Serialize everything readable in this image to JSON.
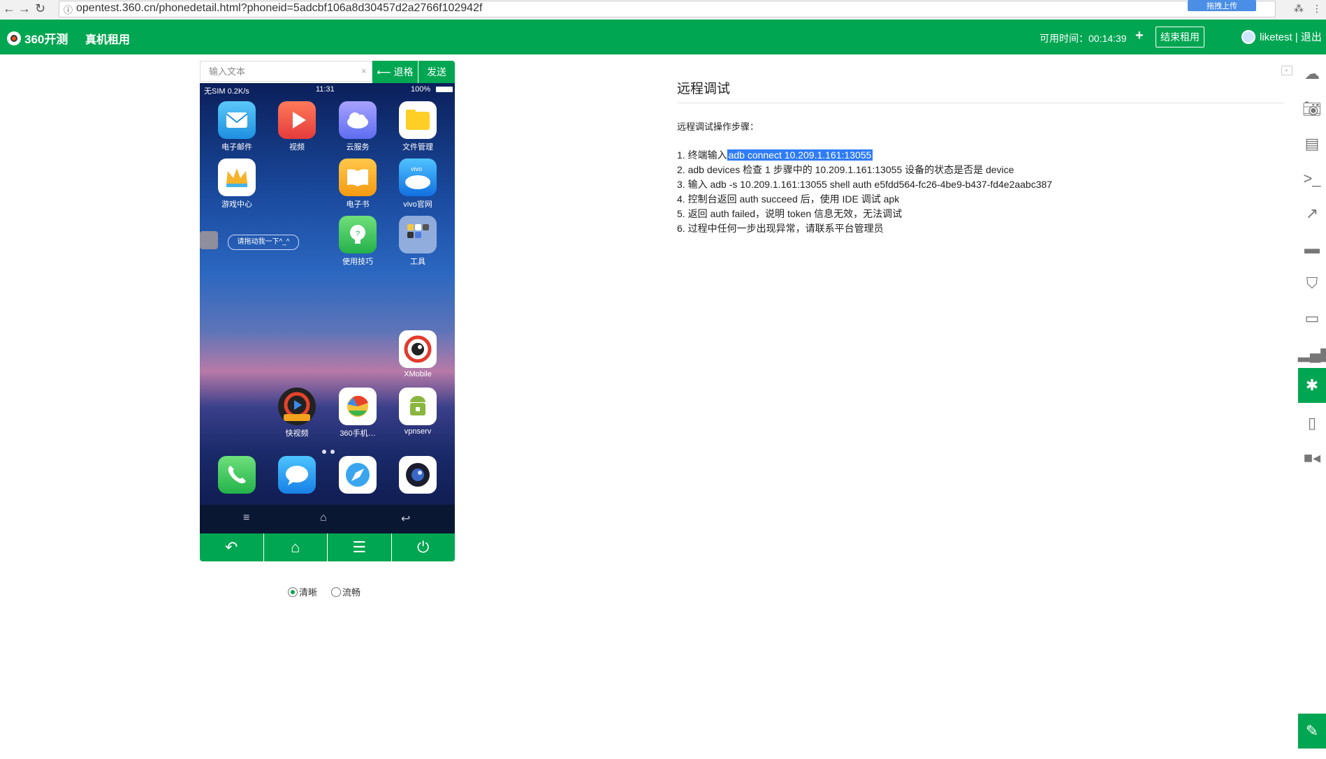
{
  "browser": {
    "url": "opentest.360.cn/phonedetail.html?phoneid=5adcbf106a8d30457d2a2766f102942f",
    "upload_label": "拖拽上传"
  },
  "header": {
    "logo_text": "360开测",
    "nav_rent": "真机租用",
    "timer": "可用时间：00:14:39",
    "end_rent": "结束租用",
    "user": "liketest | 退出",
    "brand_color": "#00a651"
  },
  "phone": {
    "input_placeholder": "输入文本",
    "backspace": "⟵ 退格",
    "send": "发送",
    "status_left": "无SIM 0.2K/s",
    "status_time": "11:31",
    "status_batt": "100%",
    "drag_hint": "请拖动我一下^_^",
    "apps": [
      {
        "label": "电子邮件"
      },
      {
        "label": "视频"
      },
      {
        "label": "云服务"
      },
      {
        "label": "文件管理"
      },
      {
        "label": "游戏中心"
      },
      {
        "label": "电子书"
      },
      {
        "label": "vivo官网"
      },
      {
        "label": "使用技巧"
      },
      {
        "label": "工具"
      },
      {
        "label": "XMobile"
      },
      {
        "label": "快视频"
      },
      {
        "label": "360手机…"
      },
      {
        "label": "vpnserv"
      }
    ],
    "quality": {
      "clear": "清晰",
      "smooth": "流畅",
      "selected": "清晰"
    }
  },
  "panel": {
    "title": "远程调试",
    "steps_head": "远程调试操作步骤：",
    "step1_prefix": "1. 终端输入",
    "step1_cmd": "adb connect 10.209.1.161:13055",
    "step2": "2. adb devices 检查 1 步骤中的 10.209.1.161:13055 设备的状态是否是 device",
    "step3": "3. 输入 adb -s 10.209.1.161:13055 shell auth e5fdd564-fc26-4be9-b437-fd4e2aabc387",
    "step4": "4. 控制台返回 auth succeed 后，使用 IDE 调试 apk",
    "step5": "5. 返回 auth failed，说明 token 信息无效，无法调试",
    "step6": "6. 过程中任何一步出现异常，请联系平台管理员"
  },
  "sidebar": [
    "cloud-upload-icon",
    "camera-icon",
    "document-icon",
    "terminal-icon",
    "chart-icon",
    "folder-icon",
    "html5-icon",
    "battery-icon",
    "signal-icon",
    "bug-icon",
    "phone-icon",
    "video-icon"
  ]
}
